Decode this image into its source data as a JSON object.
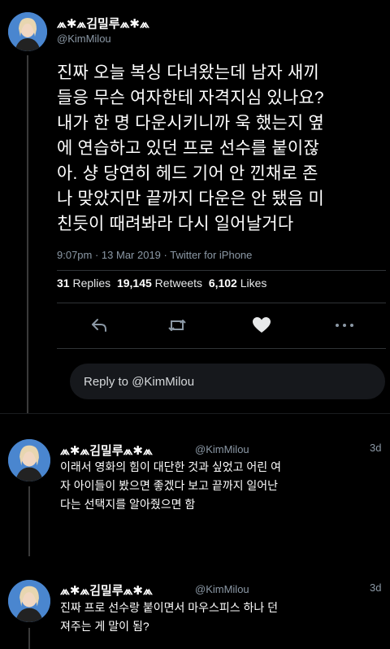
{
  "main_tweet": {
    "display_name": "⩕✱⩕김밀루⩕✱⩕",
    "handle": "@KimMilou",
    "text_lines": [
      "진짜 오늘 복싱 다녀왔는데 남자 새끼",
      "들응 무슨 여자한테 자격지심 있나요?",
      "내가 한 명 다운시키니까 욱 했는지 옆",
      "에 연습하고 있던 프로 선수를 붙이잖",
      "아. 샹 당연히 헤드 기어 안 낀채로 존",
      "나 맞았지만 끝까지 다운은 안 됐음 미",
      "친듯이 때려봐라 다시 일어날거다"
    ],
    "timestamp": "9:07pm · 13 Mar 2019 · Twitter for iPhone",
    "replies_count": "31",
    "replies_label": "Replies",
    "retweets_count": "19,145",
    "retweets_label": "Retweets",
    "likes_count": "6,102",
    "likes_label": "Likes"
  },
  "actions": {
    "reply_icon": "reply-icon",
    "retweet_icon": "retweet-icon",
    "like_icon": "heart-icon",
    "more_icon": "more-icon"
  },
  "reply_box": {
    "placeholder": "Reply to @KimMilou"
  },
  "replies": [
    {
      "display_name": "⩕✱⩕김밀루⩕✱⩕",
      "handle": "@KimMilou",
      "time": "3d",
      "text_lines": [
        "이래서 영화의 힘이 대단한 것과 싶었고 어린 여",
        "자 아이들이 봤으면 좋겠다 보고 끝까지 일어난",
        "다는 선택지를 알아줬으면 함"
      ]
    },
    {
      "display_name": "⩕✱⩕김밀루⩕✱⩕",
      "handle": "@KimMilou",
      "time": "3d",
      "text_lines": [
        "진짜 프로 선수랑 붙이면서 마우스피스 하나 던",
        "져주는 게 말이 됨?"
      ]
    }
  ],
  "colors": {
    "background": "#000000",
    "text": "#ffffff",
    "secondary": "#8b98a5",
    "avatar_bg": "#2c6fc2"
  }
}
